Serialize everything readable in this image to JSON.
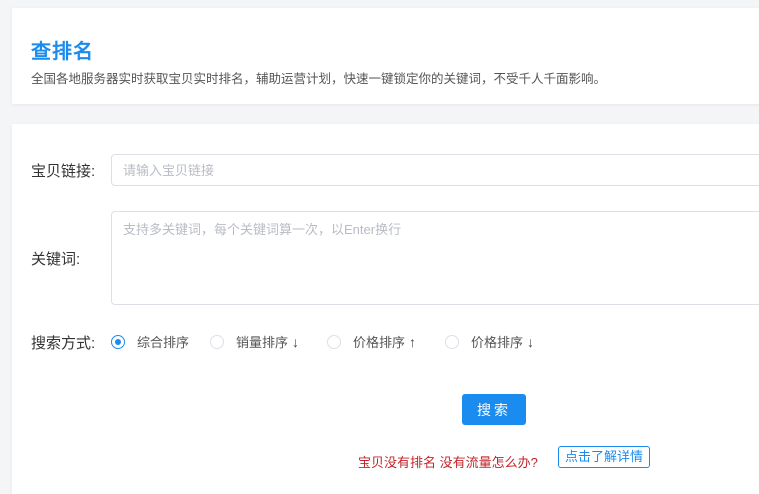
{
  "header": {
    "title": "查排名",
    "subtitle": "全国各地服务器实时获取宝贝实时排名，辅助运营计划，快速一键锁定你的关键词，不受千人千面影响。"
  },
  "form": {
    "link_label": "宝贝链接:",
    "link_placeholder": "请输入宝贝链接",
    "link_value": "",
    "keyword_label": "关键词:",
    "keyword_placeholder": "支持多关键词，每个关键词算一次，以Enter换行",
    "keyword_value": "",
    "sort_label": "搜索方式:",
    "sort_options": [
      {
        "label": "综合排序",
        "arrow": "",
        "checked": true
      },
      {
        "label": "销量排序",
        "arrow": "↓",
        "checked": false
      },
      {
        "label": "价格排序",
        "arrow": "↑",
        "checked": false
      },
      {
        "label": "价格排序",
        "arrow": "↓",
        "checked": false
      }
    ],
    "search_button": "搜索"
  },
  "help": {
    "text": "宝贝没有排名 没有流量怎么办?",
    "link": "点击了解详情"
  },
  "colors": {
    "accent": "#1a8cf0",
    "help_text": "#c3242a"
  }
}
